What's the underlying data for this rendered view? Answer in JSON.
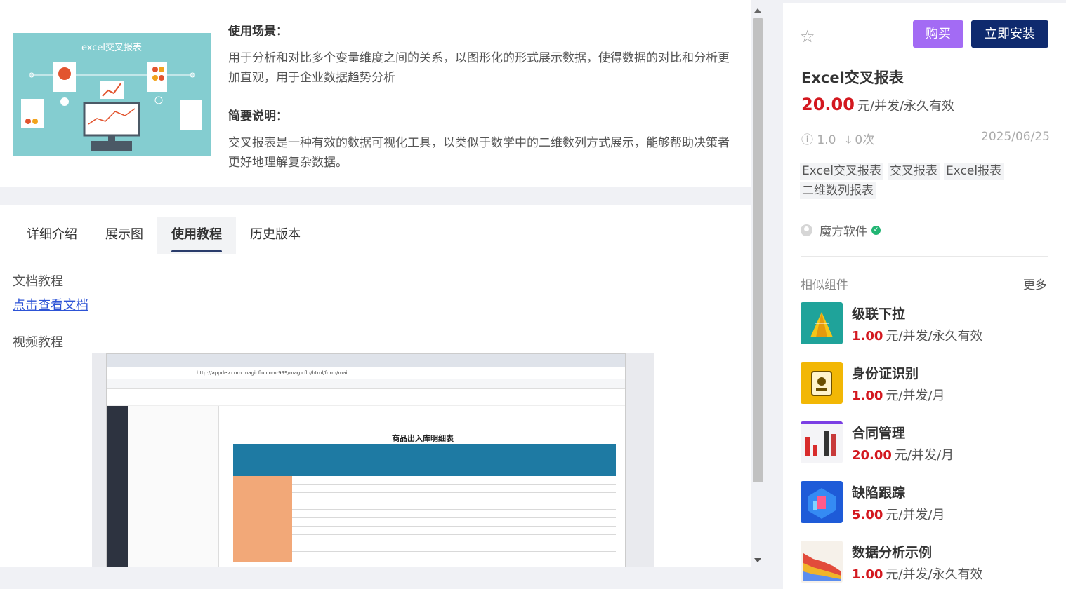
{
  "product": {
    "cover_title": "excel交叉报表",
    "usage_heading": "使用场景：",
    "usage_text": "用于分析和对比多个变量维度之间的关系，以图形化的形式展示数据，使得数据的对比和分析更加直观，用于企业数据趋势分析",
    "summary_heading": "简要说明：",
    "summary_text": "交叉报表是一种有效的数据可视化工具，以类似于数学中的二维数列方式展示，能够帮助决策者更好地理解复杂数据。"
  },
  "tabs": [
    {
      "label": "详细介绍",
      "active": false
    },
    {
      "label": "展示图",
      "active": false
    },
    {
      "label": "使用教程",
      "active": true
    },
    {
      "label": "历史版本",
      "active": false
    }
  ],
  "tutorial": {
    "doc_label": "文档教程",
    "doc_link": "点击查看文档",
    "video_label": "视频教程",
    "video_url_text": "http://appdev.com.magicflu.com:999/magicflu/html/form/mai",
    "video_sheet_title": "商品出入库明细表"
  },
  "sidebar": {
    "buy_label": "购买",
    "install_label": "立即安装",
    "name": "Excel交叉报表",
    "price_amount": "20.00",
    "price_unit": "元/并发/永久有效",
    "version": "1.0",
    "downloads": "0次",
    "date": "2025/06/25",
    "tags": [
      "Excel交叉报表",
      "交叉报表",
      "Excel报表",
      "二维数列报表"
    ],
    "author": "魔方软件",
    "similar_title": "相似组件",
    "more_label": "更多",
    "similar": [
      {
        "name": "级联下拉",
        "amount": "1.00",
        "unit": "元/并发/永久有效",
        "thumb_color": "#1fa39a"
      },
      {
        "name": "身份证识别",
        "amount": "1.00",
        "unit": "元/并发/月",
        "thumb_color": "#f2b705"
      },
      {
        "name": "合同管理",
        "amount": "20.00",
        "unit": "元/并发/月",
        "thumb_color": "#f4f4f7"
      },
      {
        "name": "缺陷跟踪",
        "amount": "5.00",
        "unit": "元/并发/月",
        "thumb_color": "#1e5bd8"
      },
      {
        "name": "数据分析示例",
        "amount": "1.00",
        "unit": "元/并发/永久有效",
        "thumb_color": "#f6f1ea"
      }
    ]
  },
  "colors": {
    "brand_purple": "#a36bf4",
    "brand_navy": "#0f2a6e",
    "price_red": "#d3181f",
    "link_blue": "#2d53d6"
  }
}
